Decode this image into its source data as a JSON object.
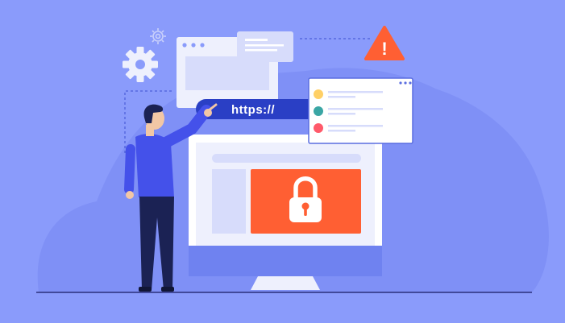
{
  "address_bar": {
    "url_text": "https://"
  },
  "alert": {
    "symbol": "!"
  },
  "colors": {
    "background": "#8a9bfb",
    "blob": "#7f90f6",
    "monitor_frame": "#ffffff",
    "monitor_bezel": "#6f82f0",
    "screen": "#eef0fd",
    "sidebar_block": "#d7dcfb",
    "lock_panel": "#ff5f33",
    "address_bar": "#2a3fc5",
    "warning": "#ff5f33",
    "person_shirt": "#4451ea",
    "person_pants": "#1b2254",
    "popup_dot_yellow": "#ffd066",
    "popup_dot_teal": "#3aa6a4",
    "popup_dot_red": "#ff5a6a"
  },
  "icons": [
    "gear-icon",
    "warning-icon",
    "padlock-icon",
    "browser-window-icon",
    "message-card-icon"
  ]
}
